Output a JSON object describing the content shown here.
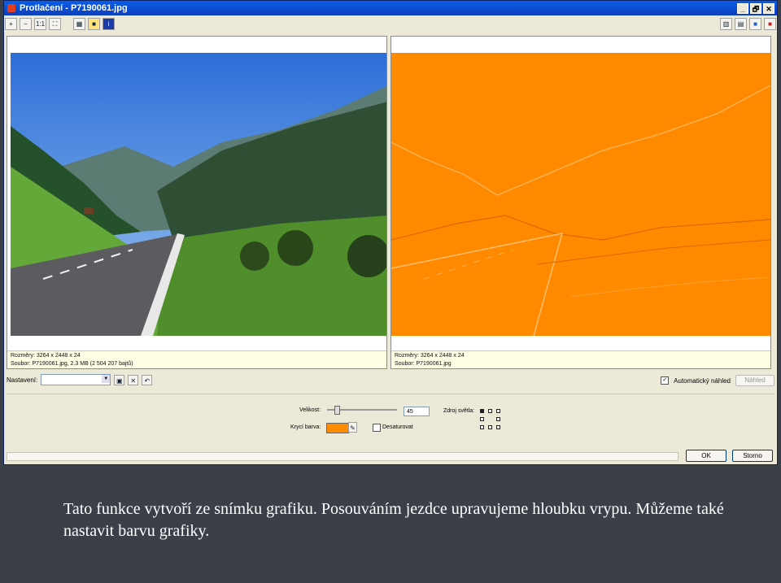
{
  "window": {
    "title": "Protlačení - P7190061.jpg"
  },
  "title_controls": [
    "_",
    "🗗",
    "✕"
  ],
  "toolbar_left": [
    "zoom-in-icon",
    "zoom-out-icon",
    "actual-size-icon",
    "fit-window-icon",
    "image-view-icon",
    "highlight-icon",
    "info-icon"
  ],
  "toolbar_right": [
    "side-by-side-icon",
    "stacked-icon",
    "single-view-icon",
    "preview-only-icon"
  ],
  "left_pane": {
    "dimensions": "Rozměry: 3264 x 2448 x 24",
    "file": "Soubor: P7190061.jpg, 2.3 MB (2 504 207 bajtů)"
  },
  "right_pane": {
    "dimensions": "Rozměry: 3264 x 2448 x 24",
    "file": "Soubor: P7190061.jpg"
  },
  "settings": {
    "label": "Nastavení:",
    "value": ""
  },
  "auto_preview": {
    "label": "Automatický náhled",
    "checked": true,
    "preview_button": "Náhled"
  },
  "controls": {
    "size_label": "Velikost:",
    "size_value": "45",
    "fill_label": "Krycí barva:",
    "fill_color": "#ff8c00",
    "desaturate_label": "Desaturovat",
    "light_label": "Zdroj světla:"
  },
  "buttons": {
    "ok": "OK",
    "cancel": "Storno"
  },
  "caption": "Tato funkce vytvoří ze snímku grafiku. Posouváním jezdce upravujeme hloubku vrypu. Můžeme také nastavit barvu grafiky."
}
